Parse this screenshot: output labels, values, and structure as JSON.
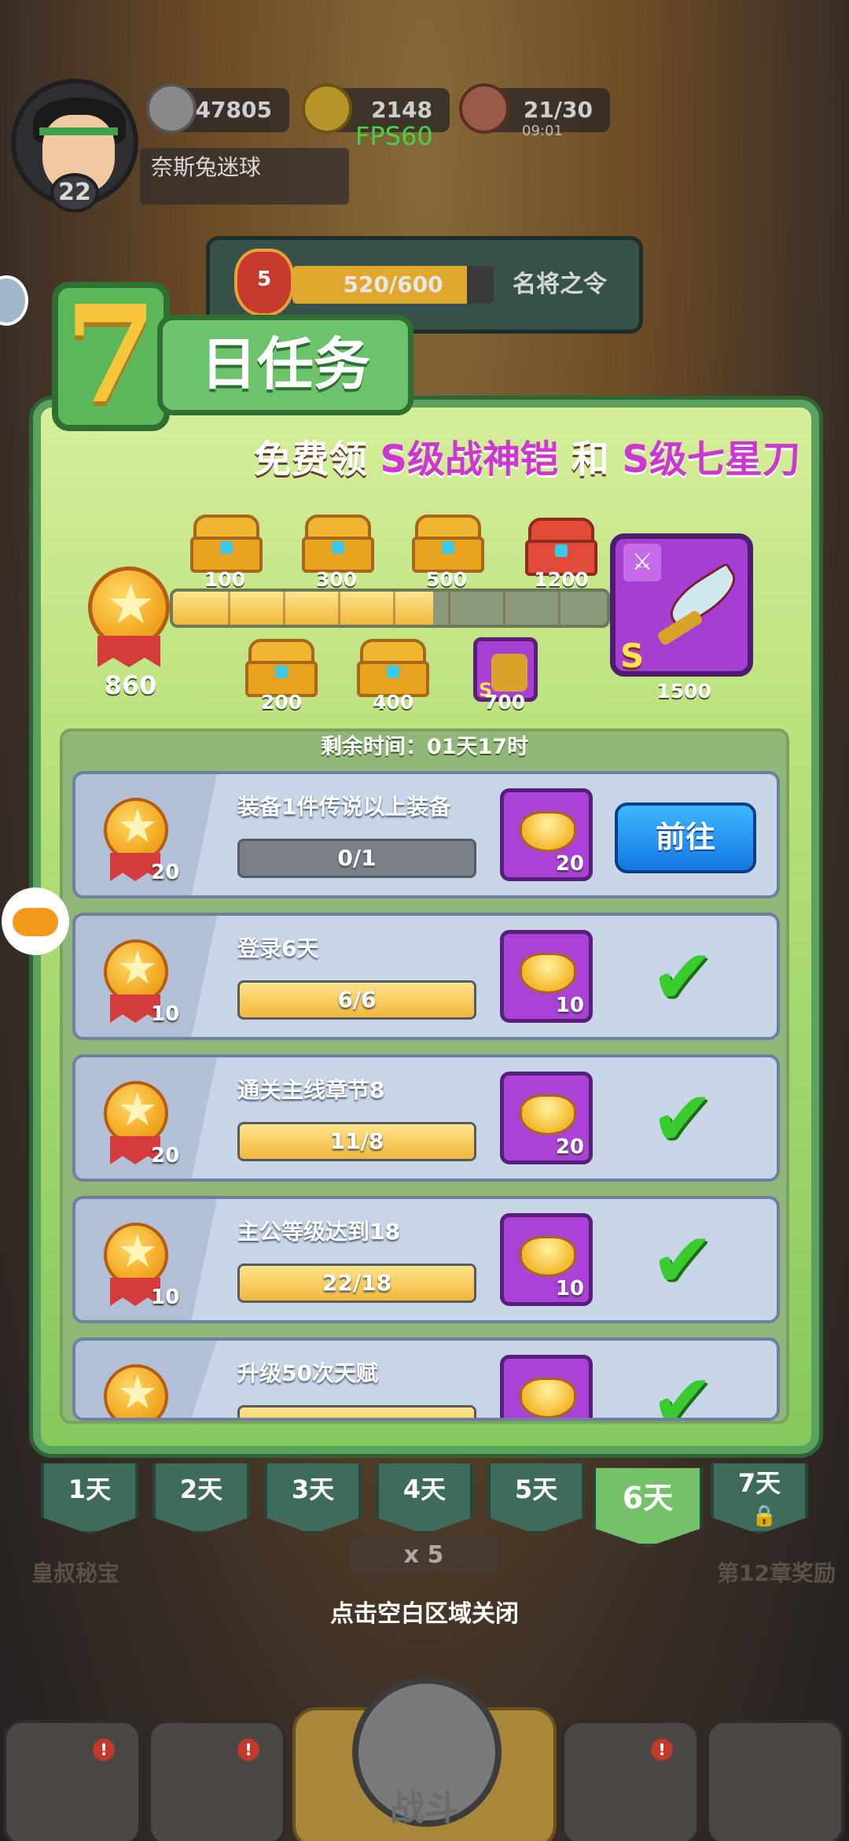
{
  "hud": {
    "player_level": "22",
    "player_name": "奈斯兔迷球",
    "silver": "47805",
    "gold": "2148",
    "stamina": "21/30",
    "stamina_timer": "09:01",
    "fps": "FPS60",
    "token_rank": "5",
    "token_progress": "520/600",
    "token_progress_fraction": 0.8667,
    "token_label": "名将之令"
  },
  "title": {
    "number": "7",
    "text": "日任务"
  },
  "promo": {
    "prefix": "免费领 ",
    "item1": "S级战神铠",
    "mid": " 和 ",
    "item2": "S级七星刀"
  },
  "progress": {
    "current_score": "860",
    "fill_fraction": 0.6,
    "milestones_top": [
      "100",
      "300",
      "500",
      "1200"
    ],
    "milestones_bottom": [
      "200",
      "400",
      "700"
    ],
    "final_reward_score": "1500",
    "final_reward_grade": "S",
    "armor_grade": "S"
  },
  "tasks_header": {
    "remaining_time": "剩余时间：01天17时"
  },
  "tasks": [
    {
      "name": "装备1件传说以上装备",
      "medal": "20",
      "progress": "0/1",
      "fraction": 0,
      "reward": "20",
      "state": "go",
      "button": "前往"
    },
    {
      "name": "登录6天",
      "medal": "10",
      "progress": "6/6",
      "fraction": 1,
      "reward": "10",
      "state": "done"
    },
    {
      "name": "通关主线章节8",
      "medal": "20",
      "progress": "11/8",
      "fraction": 1,
      "reward": "20",
      "state": "done"
    },
    {
      "name": "主公等级达到18",
      "medal": "10",
      "progress": "22/18",
      "fraction": 1,
      "reward": "10",
      "state": "done"
    },
    {
      "name": "升级50次天赋",
      "medal": "",
      "progress": "",
      "fraction": 1,
      "reward": "",
      "state": "done"
    }
  ],
  "days": [
    "1天",
    "2天",
    "3天",
    "4天",
    "5天",
    "6天",
    "7天"
  ],
  "active_day_index": 5,
  "locked_day_index": 6,
  "bottom": {
    "left_label": "皇叔秘宝",
    "right_label": "第12章奖励",
    "cost": "x 5",
    "close_hint": "点击空白区域关闭",
    "battle_label": "战斗",
    "badge": "!"
  },
  "colors": {
    "panel_green": "#86c85e",
    "task_bg": "#c7d5e6",
    "reward_purple": "#ab41d6",
    "go_button_blue": "#1477e2",
    "check_green": "#3acb2f",
    "promo_purple": "#cc38cf"
  },
  "icons": {
    "check": "✔",
    "lock": "🔒",
    "star": "★"
  }
}
